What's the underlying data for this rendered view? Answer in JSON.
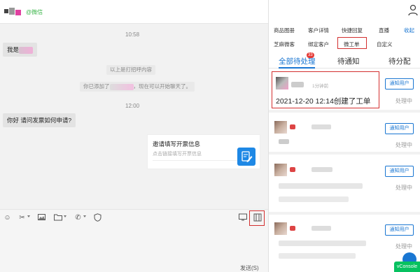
{
  "chat": {
    "contact_suffix": "@微信",
    "times": [
      "10:58",
      "12:00"
    ],
    "greeting_prefix": "我是",
    "system_msgs": {
      "opened": "以上是打招呼内容",
      "added_prefix": "你已添加了",
      "added_suffix": "，现在可以开始聊天了。"
    },
    "customer_question": "你好 请问发票如何申请?",
    "card": {
      "title": "邀请填写开票信息",
      "subtitle": "点击链接填写开票信息"
    },
    "send_label": "发送(S)",
    "toolbar_icons": [
      "emoji-icon",
      "scissors-icon",
      "image-icon",
      "folder-icon",
      "phone-icon",
      "shield-icon",
      "screen-icon",
      "work-order-icon"
    ]
  },
  "side": {
    "menu_row1": [
      "商品图册",
      "客户详情",
      "快捷回复",
      "直播",
      "收起"
    ],
    "menu_row2": [
      "芝麻微客",
      "绑定客户",
      "微工单",
      "自定义"
    ],
    "tabs": [
      "全部待处理",
      "待通知",
      "待分配"
    ],
    "badge": "33",
    "items": [
      {
        "time": "1分钟前",
        "text": "2021-12-20 12:14创建了工单",
        "button": "通知用户",
        "status": "处理中"
      },
      {
        "button": "通知用户",
        "status": "处理中"
      },
      {
        "button": "通知用户",
        "status": "处理中"
      },
      {
        "button": "通知用户",
        "status": "处理中"
      }
    ],
    "vconsole": "vConsole"
  },
  "colors": {
    "accent": "#1976d2",
    "highlight": "#d32f2f",
    "wechat": "#3bb54a",
    "badge": "#e53935",
    "vconsole": "#07c160"
  }
}
